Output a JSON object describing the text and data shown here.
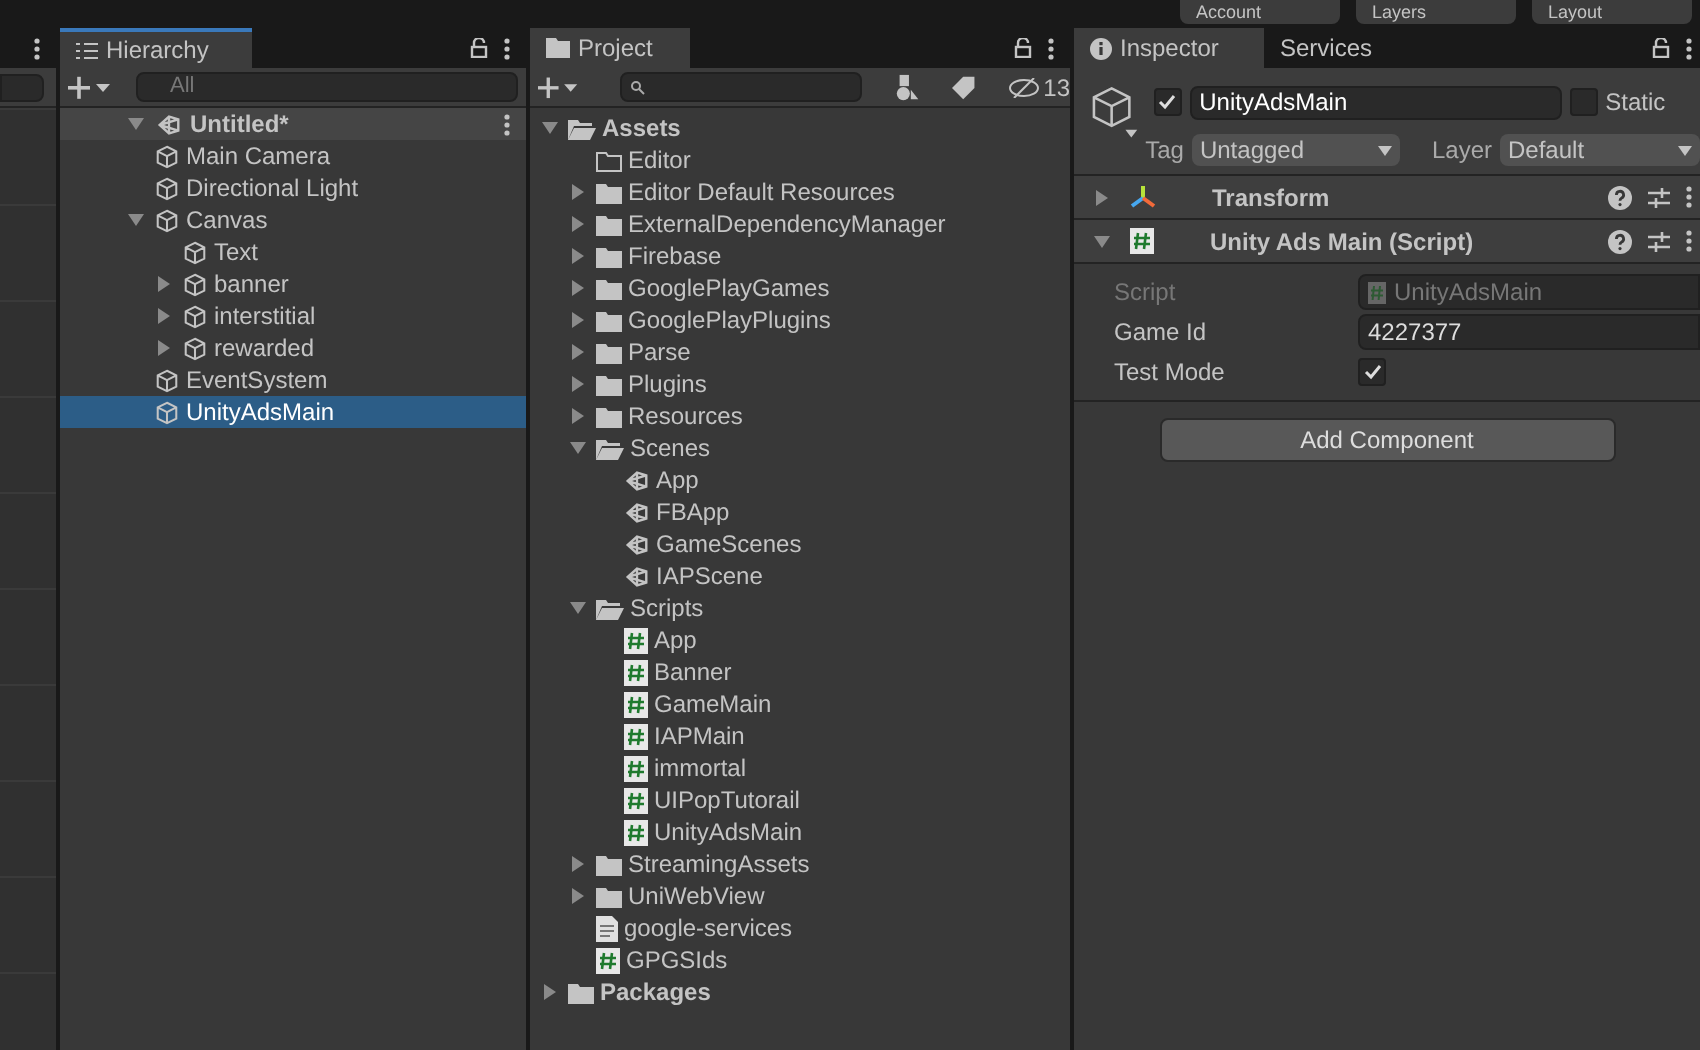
{
  "toolbar": {
    "buttons": [
      "Account",
      "Layers",
      "Layout"
    ]
  },
  "hierarchy": {
    "tab": "Hierarchy",
    "search": {
      "placeholder": "All"
    },
    "scene": {
      "name": "Untitled*",
      "expanded": true
    },
    "items": [
      {
        "name": "Main Camera",
        "selected": false
      },
      {
        "name": "Directional Light",
        "selected": false
      },
      {
        "name": "Canvas",
        "selected": false,
        "expanded": true,
        "children": [
          {
            "name": "Text",
            "selected": false
          },
          {
            "name": "banner",
            "selected": false,
            "expanded": false
          },
          {
            "name": "interstitial",
            "selected": false,
            "expanded": false
          },
          {
            "name": "rewarded",
            "selected": false,
            "expanded": false
          }
        ]
      },
      {
        "name": "EventSystem",
        "selected": false
      },
      {
        "name": "UnityAdsMain",
        "selected": true
      }
    ]
  },
  "project": {
    "tab": "Project",
    "hidden_count": "13",
    "tree": [
      {
        "name": "Assets",
        "kind": "folder",
        "expanded": true,
        "root": true,
        "children": [
          {
            "name": "Editor",
            "kind": "empty-folder"
          },
          {
            "name": "Editor Default Resources",
            "kind": "folder",
            "expanded": false
          },
          {
            "name": "ExternalDependencyManager",
            "kind": "folder",
            "expanded": false
          },
          {
            "name": "Firebase",
            "kind": "folder",
            "expanded": false
          },
          {
            "name": "GooglePlayGames",
            "kind": "folder",
            "expanded": false
          },
          {
            "name": "GooglePlayPlugins",
            "kind": "folder",
            "expanded": false
          },
          {
            "name": "Parse",
            "kind": "folder",
            "expanded": false
          },
          {
            "name": "Plugins",
            "kind": "folder",
            "expanded": false
          },
          {
            "name": "Resources",
            "kind": "folder",
            "expanded": false
          },
          {
            "name": "Scenes",
            "kind": "folder",
            "expanded": true,
            "children": [
              {
                "name": "App",
                "kind": "scene"
              },
              {
                "name": "FBApp",
                "kind": "scene"
              },
              {
                "name": "GameScenes",
                "kind": "scene"
              },
              {
                "name": "IAPScene",
                "kind": "scene"
              }
            ]
          },
          {
            "name": "Scripts",
            "kind": "folder",
            "expanded": true,
            "children": [
              {
                "name": "App",
                "kind": "script"
              },
              {
                "name": "Banner",
                "kind": "script"
              },
              {
                "name": "GameMain",
                "kind": "script"
              },
              {
                "name": "IAPMain",
                "kind": "script"
              },
              {
                "name": "immortal",
                "kind": "script"
              },
              {
                "name": "UIPopTutorail",
                "kind": "script"
              },
              {
                "name": "UnityAdsMain",
                "kind": "script"
              }
            ]
          },
          {
            "name": "StreamingAssets",
            "kind": "folder",
            "expanded": false
          },
          {
            "name": "UniWebView",
            "kind": "folder",
            "expanded": false
          },
          {
            "name": "google-services",
            "kind": "text-file"
          },
          {
            "name": "GPGSIds",
            "kind": "script"
          }
        ]
      },
      {
        "name": "Packages",
        "kind": "folder",
        "expanded": false,
        "root": true
      }
    ]
  },
  "inspector": {
    "tabs": [
      {
        "label": "Inspector",
        "selected": true
      },
      {
        "label": "Services",
        "selected": false
      }
    ],
    "object": {
      "active": true,
      "name": "UnityAdsMain",
      "static_label": "Static",
      "static": false,
      "tag_label": "Tag",
      "tag": "Untagged",
      "layer_label": "Layer",
      "layer": "Default"
    },
    "components": [
      {
        "name": "Transform",
        "kind": "transform",
        "expanded": false
      },
      {
        "name": "Unity Ads Main (Script)",
        "kind": "script",
        "expanded": true
      }
    ],
    "fields": [
      {
        "label": "Script",
        "kind": "object",
        "value": "UnityAdsMain",
        "disabled": true
      },
      {
        "label": "Game Id",
        "kind": "text",
        "value": "4227377",
        "disabled": false
      },
      {
        "label": "Test Mode",
        "kind": "toggle",
        "checked": true,
        "disabled": false
      }
    ],
    "add_button": "Add Component"
  }
}
